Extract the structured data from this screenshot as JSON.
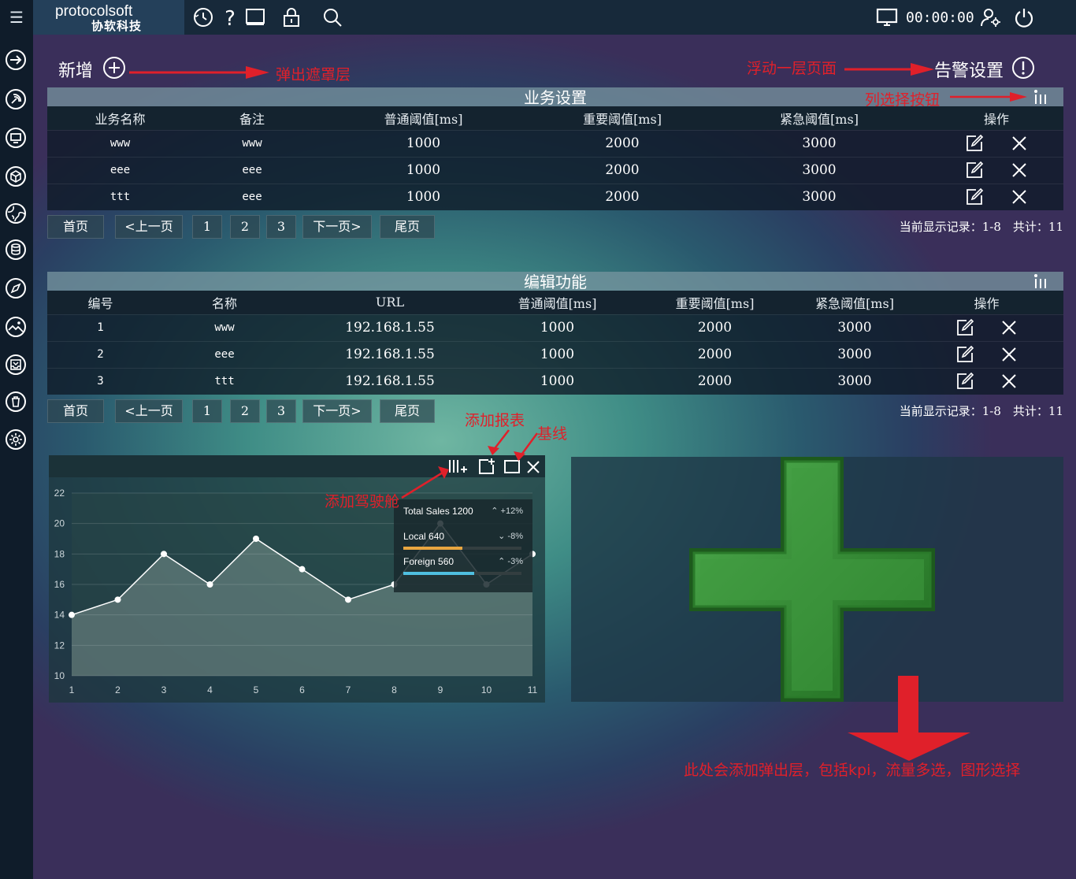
{
  "header": {
    "logo_en": "protocolsoft",
    "logo_cn": "协软科技",
    "timer": "00:00:00",
    "icons": [
      "menu-icon",
      "clock-icon",
      "help-icon",
      "monitor-icon",
      "lock-icon",
      "search-icon",
      "screen-icon",
      "user-settings-icon",
      "power-icon"
    ]
  },
  "sidebar": {
    "icons": [
      "arrow-right-icon",
      "signal-icon",
      "monitor-icon",
      "cube-icon",
      "globe-icon",
      "database-icon",
      "compass-icon",
      "image-icon",
      "inbox-icon",
      "trash-icon",
      "settings-icon"
    ]
  },
  "page": {
    "add_label": "新增",
    "alarm_label": "告警设置"
  },
  "annotations": {
    "popup_mask": "弹出遮罩层",
    "float_page": "浮动一层页面",
    "column_select": "列选择按钮",
    "add_report": "添加报表",
    "baseline": "基线",
    "add_dashboard": "添加驾驶舱",
    "bottom_note": "此处会添加弹出层，包括kpi，流量多选，图形选择"
  },
  "business": {
    "title": "业务设置",
    "headers": [
      "业务名称",
      "备注",
      "普通阈值[ms]",
      "重要阈值[ms]",
      "紧急阈值[ms]",
      "操作"
    ],
    "rows": [
      {
        "name": "www",
        "note": "www",
        "normal": "1000",
        "important": "2000",
        "urgent": "3000"
      },
      {
        "name": "eee",
        "note": "eee",
        "normal": "1000",
        "important": "2000",
        "urgent": "3000"
      },
      {
        "name": "ttt",
        "note": "eee",
        "normal": "1000",
        "important": "2000",
        "urgent": "3000"
      }
    ]
  },
  "pager1": {
    "first": "首页",
    "prev": "<上一页",
    "p1": "1",
    "p2": "2",
    "p3": "3",
    "next": "下一页>",
    "last": "尾页",
    "record": "当前显示记录：1-8　共计：11"
  },
  "edit": {
    "title": "编辑功能",
    "headers": [
      "编号",
      "名称",
      "URL",
      "普通阈值[ms]",
      "重要阈值[ms]",
      "紧急阈值[ms]",
      "操作"
    ],
    "rows": [
      {
        "id": "1",
        "name": "www",
        "url": "192.168.1.55",
        "normal": "1000",
        "important": "2000",
        "urgent": "3000"
      },
      {
        "id": "2",
        "name": "eee",
        "url": "192.168.1.55",
        "normal": "1000",
        "important": "2000",
        "urgent": "3000"
      },
      {
        "id": "3",
        "name": "ttt",
        "url": "192.168.1.55",
        "normal": "1000",
        "important": "2000",
        "urgent": "3000"
      }
    ]
  },
  "pager2": {
    "first": "首页",
    "prev": "<上一页",
    "p1": "1",
    "p2": "2",
    "p3": "3",
    "next": "下一页>",
    "last": "尾页",
    "record": "当前显示记录：1-8　共计：11"
  },
  "chart_data": {
    "type": "area",
    "x": [
      1,
      2,
      3,
      4,
      5,
      6,
      7,
      8,
      9,
      10,
      11
    ],
    "series": [
      {
        "values": [
          14,
          15,
          18,
          16,
          19,
          17,
          15,
          16,
          20,
          16,
          18
        ]
      }
    ],
    "ylim": [
      10,
      22
    ],
    "yticks": [
      10,
      12,
      14,
      16,
      18,
      20,
      22
    ],
    "legend_position": "top-right",
    "kpi": [
      {
        "label": "Total Sales 1200",
        "change": "+12%",
        "dir": "up",
        "bar_color": "",
        "fill": 0
      },
      {
        "label": "Local 640",
        "change": "-8%",
        "dir": "down",
        "bar_color": "#e8a640",
        "fill": 0.5
      },
      {
        "label": "Foreign 560",
        "change": "-3%",
        "dir": "up",
        "bar_color": "#4fbfe0",
        "fill": 0.6
      }
    ]
  },
  "colors": {
    "accent_red": "#e0202a",
    "plus_green": "#2e8a2e"
  }
}
